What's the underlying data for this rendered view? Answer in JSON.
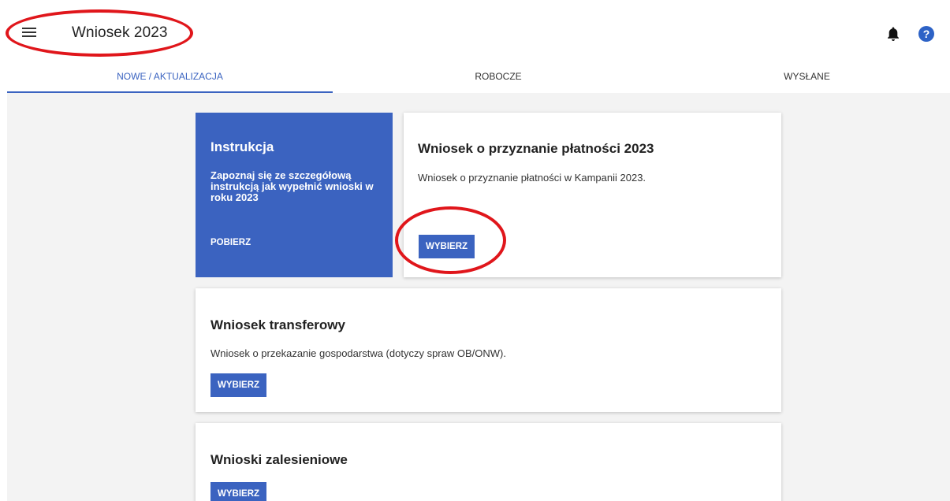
{
  "header": {
    "title": "Wniosek 2023",
    "help_glyph": "?"
  },
  "tabs": [
    {
      "label": "NOWE / AKTUALIZACJA",
      "active": true
    },
    {
      "label": "ROBOCZE",
      "active": false
    },
    {
      "label": "WYSŁANE",
      "active": false
    }
  ],
  "instruction_card": {
    "title": "Instrukcja",
    "description": "Zapoznaj się ze szczegółową instrukcją jak wypełnić wnioski w roku 2023",
    "link_label": "POBIERZ"
  },
  "cards": [
    {
      "title": "Wniosek o przyznanie płatności 2023",
      "description": "Wniosek o przyznanie płatności w Kampanii 2023.",
      "button_label": "WYBIERZ"
    },
    {
      "title": "Wniosek transferowy",
      "description": "Wniosek o przekazanie gospodarstwa (dotyczy spraw OB/ONW).",
      "button_label": "WYBIERZ"
    },
    {
      "title": "Wnioski zalesieniowe",
      "button_label": "WYBIERZ"
    }
  ],
  "colors": {
    "accent": "#3b63c0",
    "annotation": "#e0161b",
    "background": "#f3f3f3"
  },
  "icons": [
    "menu-icon",
    "bell-icon",
    "help-icon"
  ]
}
